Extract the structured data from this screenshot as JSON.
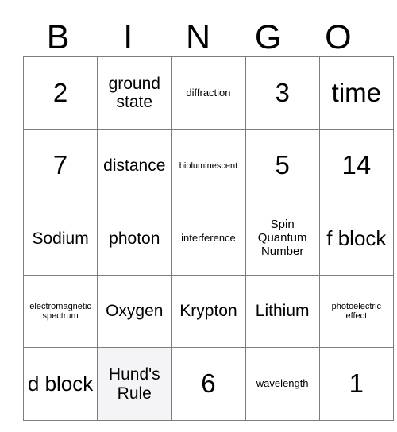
{
  "card": {
    "title": "BINGO",
    "header": {
      "letters": [
        "B",
        "I",
        "N",
        "G",
        "O"
      ]
    },
    "colors": {
      "border": "#7d7d7d",
      "text": "#000000",
      "cell_background": "#ffffff",
      "marked_background": "#f4f4f6"
    },
    "grid": {
      "columns": 5,
      "rows": 5,
      "cells": [
        [
          {
            "text": "2",
            "size": "sz-xl",
            "marked": false
          },
          {
            "text": "ground state",
            "size": "sz-md",
            "marked": false
          },
          {
            "text": "diffraction",
            "size": "sz-xs",
            "marked": false
          },
          {
            "text": "3",
            "size": "sz-xl",
            "marked": false
          },
          {
            "text": "time",
            "size": "sz-xl",
            "marked": false
          }
        ],
        [
          {
            "text": "7",
            "size": "sz-xl",
            "marked": false
          },
          {
            "text": "distance",
            "size": "sz-md",
            "marked": false
          },
          {
            "text": "bioluminescent",
            "size": "sz-xxs",
            "marked": false
          },
          {
            "text": "5",
            "size": "sz-xl",
            "marked": false
          },
          {
            "text": "14",
            "size": "sz-xl",
            "marked": false
          }
        ],
        [
          {
            "text": "Sodium",
            "size": "sz-md",
            "marked": false
          },
          {
            "text": "photon",
            "size": "sz-md",
            "marked": false
          },
          {
            "text": "interference",
            "size": "sz-xs",
            "marked": false
          },
          {
            "text": "Spin Quantum Number",
            "size": "sz-sm",
            "marked": false
          },
          {
            "text": "f block",
            "size": "sz-lg",
            "marked": false
          }
        ],
        [
          {
            "text": "electromagnetic spectrum",
            "size": "sz-xxs",
            "marked": false
          },
          {
            "text": "Oxygen",
            "size": "sz-md",
            "marked": false
          },
          {
            "text": "Krypton",
            "size": "sz-md",
            "marked": false
          },
          {
            "text": "Lithium",
            "size": "sz-md",
            "marked": false
          },
          {
            "text": "photoelectric effect",
            "size": "sz-xxs",
            "marked": false
          }
        ],
        [
          {
            "text": "d block",
            "size": "sz-lg",
            "marked": false
          },
          {
            "text": "Hund's Rule",
            "size": "sz-md",
            "marked": true
          },
          {
            "text": "6",
            "size": "sz-xl",
            "marked": false
          },
          {
            "text": "wavelength",
            "size": "sz-xs",
            "marked": false
          },
          {
            "text": "1",
            "size": "sz-xl",
            "marked": false
          }
        ]
      ]
    }
  }
}
